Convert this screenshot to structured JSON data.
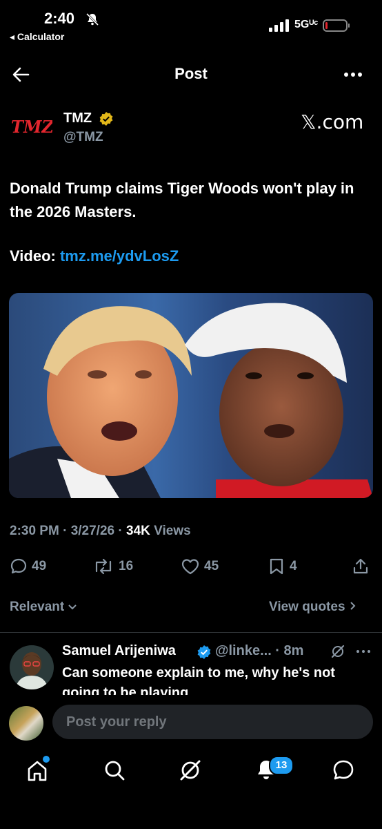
{
  "status_bar": {
    "time": "2:40",
    "back_app": "◂ Calculator",
    "network": "5Gᵁᶜ"
  },
  "header": {
    "title": "Post"
  },
  "post": {
    "author_name": "TMZ",
    "author_handle": "@TMZ",
    "logo_text": "TMZ",
    "source": "𝕏.com",
    "text": "Donald Trump claims Tiger Woods won't play in the 2026 Masters.",
    "video_label": "Video:",
    "video_link": "tmz.me/ydvLosZ",
    "time": "2:30 PM",
    "date": "3/27/26",
    "views_count": "34K",
    "views_label": "Views"
  },
  "actions": {
    "replies": "49",
    "reposts": "16",
    "likes": "45",
    "bookmarks": "4"
  },
  "replies_section": {
    "sort_label": "Relevant",
    "view_quotes_label": "View quotes"
  },
  "reply": {
    "name": "Samuel Arijeniwa",
    "handle": "@linke...",
    "time": "8m",
    "text": "Can someone explain to me, why he's not going to be playing"
  },
  "composer": {
    "placeholder": "Post your reply"
  },
  "tabbar": {
    "notifications_badge": "13"
  },
  "colors": {
    "accent": "#1d9bf0",
    "verified_gold": "#e2b719",
    "tmz_red": "#e3262e",
    "muted": "#8b98a5"
  }
}
